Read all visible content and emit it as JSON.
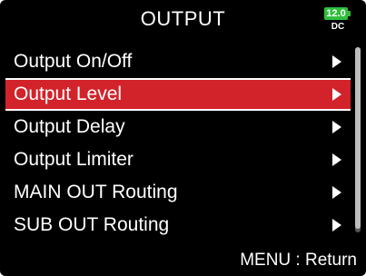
{
  "header": {
    "title": "OUTPUT",
    "battery": {
      "level_text": "12.0",
      "source": "DC",
      "color": "#2fbf3a"
    }
  },
  "menu": {
    "items": [
      {
        "label": "Output On/Off",
        "selected": false,
        "icon": "chevron-right-icon"
      },
      {
        "label": "Output Level",
        "selected": true,
        "icon": "chevron-right-icon"
      },
      {
        "label": "Output Delay",
        "selected": false,
        "icon": "chevron-right-icon"
      },
      {
        "label": "Output Limiter",
        "selected": false,
        "icon": "chevron-right-icon"
      },
      {
        "label": "MAIN OUT Routing",
        "selected": false,
        "icon": "chevron-right-icon"
      },
      {
        "label": "SUB OUT Routing",
        "selected": false,
        "icon": "chevron-right-icon"
      }
    ],
    "selected_color": "#d2232a"
  },
  "footer": {
    "hint": "MENU : Return"
  }
}
